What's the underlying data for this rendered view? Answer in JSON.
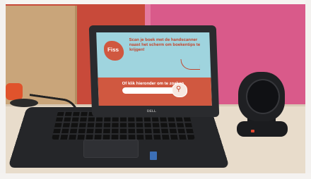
{
  "screen": {
    "logo_text": "Fiss",
    "headline": "Scan je boek met de handscanner naast het scherm om boekentips te krijgen!",
    "search_prompt": "Of klik hieronder om te zoeken",
    "search_icon": "magnifier-icon"
  },
  "laptop": {
    "brand": "DELL"
  },
  "colors": {
    "screen_bg": "#9fd4de",
    "screen_accent": "#d05840",
    "wall_red": "#c84a3a",
    "wall_pink": "#d95a8a"
  }
}
